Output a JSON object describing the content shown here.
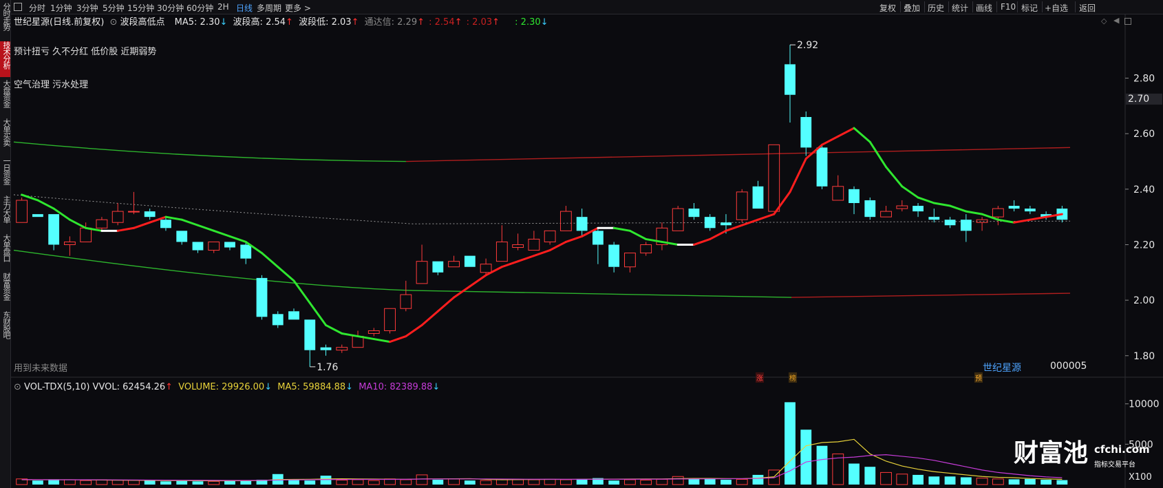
{
  "sidebar": {
    "tabs": [
      {
        "label": "分时走势",
        "active": false
      },
      {
        "label": "技术分析",
        "active": true
      },
      {
        "label": "大盘资金",
        "active": false
      },
      {
        "label": "大单买卖",
        "active": false
      },
      {
        "label": "一日资金",
        "active": false
      },
      {
        "label": "主力大单",
        "active": false
      },
      {
        "label": "大单盘口",
        "active": false
      },
      {
        "label": "财富资金",
        "active": false
      },
      {
        "label": "东财股吧",
        "active": false
      }
    ]
  },
  "toolbar": {
    "periods": [
      "分时",
      "1分钟",
      "3分钟",
      "5分钟",
      "15分钟",
      "30分钟",
      "60分钟",
      "2H",
      "日线",
      "多周期",
      "更多 >"
    ],
    "active_period": "日线",
    "tools": [
      "复权",
      "叠加",
      "历史",
      "统计",
      "画线",
      "F10",
      "标记",
      "+自选",
      "返回"
    ]
  },
  "main_header": {
    "stock_name": "世纪星源",
    "mode": "(日线.前复权)",
    "indicator": "波段高低点",
    "ma5_label": "MA5:",
    "ma5_value": "2.30",
    "ma5_arrow": "↓",
    "high_label": "波段高:",
    "high_value": "2.54",
    "high_arrow": "↑",
    "low_label": "波段低:",
    "low_value": "2.03",
    "low_arrow": "↑",
    "channel_label": "通达信:",
    "channel_value": "2.29",
    "channel_arrow": "↑",
    "extra1_value": ": 2.54",
    "extra1_arrow": "↑",
    "extra2_value": ": 2.03",
    "extra2_arrow": "↑",
    "extra3_value": ": 2.30",
    "extra3_arrow": "↓"
  },
  "tags": {
    "line1": "预计扭亏 久不分红 低价股 近期弱势",
    "line2": "空气治理 污水处理"
  },
  "footer_label": "用到未来数据",
  "stock_watermark": "世纪星源",
  "stock_code": "000005",
  "markers": [
    "涨",
    "榜",
    "预"
  ],
  "right_price_tag": "2.70",
  "vol_header": {
    "name": "VOL-TDX(5,10)",
    "vvol_label": "VVOL:",
    "vvol_value": "62454.26",
    "vvol_arrow": "↑",
    "volume_label": "VOLUME:",
    "volume_value": "29926.00",
    "volume_arrow": "↓",
    "ma5_label": "MA5:",
    "ma5_value": "59884.88",
    "ma5_arrow": "↓",
    "ma10_label": "MA10:",
    "ma10_value": "82389.88",
    "ma10_arrow": "↓"
  },
  "brand": {
    "logo": "财富池",
    "domain": "cfchi.com",
    "slogan": "指标交易平台"
  },
  "vol_unit": "X100",
  "colors": {
    "up": "#ff3b3b",
    "down": "#54ffff",
    "ma_up": "#ff1e1e",
    "ma_down": "#2fe62f",
    "channel_green": "#2db52d",
    "channel_red": "#b01e1e",
    "vol_ma5": "#e8d23a",
    "vol_ma10": "#c63cd8",
    "accent_blue": "#4ea4ff"
  },
  "chart_data": {
    "type": "candlestick",
    "title": "世纪星源(日线.前复权)",
    "price_axis": {
      "ticks": [
        1.8,
        2.0,
        2.2,
        2.4,
        2.6,
        2.8
      ],
      "range": [
        1.73,
        2.97
      ]
    },
    "annotations": [
      {
        "label": "2.92",
        "value": 2.92
      },
      {
        "label": "1.76",
        "value": 1.76
      }
    ],
    "candles": [
      {
        "o": 2.28,
        "c": 2.36,
        "h": 2.37,
        "l": 2.28
      },
      {
        "o": 2.31,
        "c": 2.3,
        "h": 2.31,
        "l": 2.3
      },
      {
        "o": 2.31,
        "c": 2.2,
        "h": 2.31,
        "l": 2.18
      },
      {
        "o": 2.2,
        "c": 2.21,
        "h": 2.23,
        "l": 2.16
      },
      {
        "o": 2.21,
        "c": 2.26,
        "h": 2.28,
        "l": 2.21
      },
      {
        "o": 2.26,
        "c": 2.29,
        "h": 2.3,
        "l": 2.25
      },
      {
        "o": 2.28,
        "c": 2.32,
        "h": 2.35,
        "l": 2.27
      },
      {
        "o": 2.32,
        "c": 2.32,
        "h": 2.39,
        "l": 2.31
      },
      {
        "o": 2.32,
        "c": 2.3,
        "h": 2.33,
        "l": 2.29
      },
      {
        "o": 2.29,
        "c": 2.26,
        "h": 2.3,
        "l": 2.25
      },
      {
        "o": 2.25,
        "c": 2.21,
        "h": 2.25,
        "l": 2.2
      },
      {
        "o": 2.21,
        "c": 2.18,
        "h": 2.21,
        "l": 2.17
      },
      {
        "o": 2.18,
        "c": 2.21,
        "h": 2.21,
        "l": 2.17
      },
      {
        "o": 2.21,
        "c": 2.19,
        "h": 2.21,
        "l": 2.18
      },
      {
        "o": 2.2,
        "c": 2.15,
        "h": 2.21,
        "l": 2.13
      },
      {
        "o": 2.08,
        "c": 1.94,
        "h": 2.09,
        "l": 1.93
      },
      {
        "o": 1.95,
        "c": 1.91,
        "h": 1.96,
        "l": 1.9
      },
      {
        "o": 1.96,
        "c": 1.93,
        "h": 1.97,
        "l": 1.93
      },
      {
        "o": 1.93,
        "c": 1.82,
        "h": 1.93,
        "l": 1.76
      },
      {
        "o": 1.83,
        "c": 1.82,
        "h": 1.84,
        "l": 1.8
      },
      {
        "o": 1.82,
        "c": 1.83,
        "h": 1.84,
        "l": 1.81
      },
      {
        "o": 1.83,
        "c": 1.87,
        "h": 1.89,
        "l": 1.83
      },
      {
        "o": 1.88,
        "c": 1.89,
        "h": 1.9,
        "l": 1.87
      },
      {
        "o": 1.89,
        "c": 1.97,
        "h": 1.97,
        "l": 1.88
      },
      {
        "o": 1.97,
        "c": 2.02,
        "h": 2.07,
        "l": 1.96
      },
      {
        "o": 2.06,
        "c": 2.14,
        "h": 2.2,
        "l": 2.06
      },
      {
        "o": 2.14,
        "c": 2.1,
        "h": 2.14,
        "l": 2.09
      },
      {
        "o": 2.12,
        "c": 2.14,
        "h": 2.16,
        "l": 2.12
      },
      {
        "o": 2.16,
        "c": 2.12,
        "h": 2.16,
        "l": 2.12
      },
      {
        "o": 2.1,
        "c": 2.13,
        "h": 2.15,
        "l": 2.09
      },
      {
        "o": 2.14,
        "c": 2.21,
        "h": 2.27,
        "l": 2.14
      },
      {
        "o": 2.19,
        "c": 2.2,
        "h": 2.24,
        "l": 2.18
      },
      {
        "o": 2.18,
        "c": 2.22,
        "h": 2.25,
        "l": 2.18
      },
      {
        "o": 2.21,
        "c": 2.25,
        "h": 2.25,
        "l": 2.2
      },
      {
        "o": 2.25,
        "c": 2.32,
        "h": 2.34,
        "l": 2.25
      },
      {
        "o": 2.3,
        "c": 2.25,
        "h": 2.33,
        "l": 2.23
      },
      {
        "o": 2.25,
        "c": 2.2,
        "h": 2.26,
        "l": 2.13
      },
      {
        "o": 2.2,
        "c": 2.12,
        "h": 2.21,
        "l": 2.1
      },
      {
        "o": 2.12,
        "c": 2.17,
        "h": 2.17,
        "l": 2.1
      },
      {
        "o": 2.17,
        "c": 2.2,
        "h": 2.21,
        "l": 2.16
      },
      {
        "o": 2.2,
        "c": 2.26,
        "h": 2.28,
        "l": 2.18
      },
      {
        "o": 2.25,
        "c": 2.33,
        "h": 2.34,
        "l": 2.25
      },
      {
        "o": 2.33,
        "c": 2.3,
        "h": 2.35,
        "l": 2.29
      },
      {
        "o": 2.3,
        "c": 2.26,
        "h": 2.31,
        "l": 2.25
      },
      {
        "o": 2.28,
        "c": 2.27,
        "h": 2.31,
        "l": 2.24
      },
      {
        "o": 2.29,
        "c": 2.39,
        "h": 2.4,
        "l": 2.28
      },
      {
        "o": 2.41,
        "c": 2.33,
        "h": 2.43,
        "l": 2.33
      },
      {
        "o": 2.32,
        "c": 2.56,
        "h": 2.56,
        "l": 2.32
      },
      {
        "o": 2.85,
        "c": 2.74,
        "h": 2.92,
        "l": 2.64
      },
      {
        "o": 2.66,
        "c": 2.55,
        "h": 2.68,
        "l": 2.52
      },
      {
        "o": 2.55,
        "c": 2.41,
        "h": 2.56,
        "l": 2.4
      },
      {
        "o": 2.36,
        "c": 2.41,
        "h": 2.45,
        "l": 2.36
      },
      {
        "o": 2.4,
        "c": 2.35,
        "h": 2.41,
        "l": 2.31
      },
      {
        "o": 2.36,
        "c": 2.3,
        "h": 2.37,
        "l": 2.29
      },
      {
        "o": 2.3,
        "c": 2.32,
        "h": 2.34,
        "l": 2.3
      },
      {
        "o": 2.33,
        "c": 2.34,
        "h": 2.36,
        "l": 2.32
      },
      {
        "o": 2.34,
        "c": 2.32,
        "h": 2.35,
        "l": 2.3
      },
      {
        "o": 2.3,
        "c": 2.29,
        "h": 2.33,
        "l": 2.28
      },
      {
        "o": 2.29,
        "c": 2.27,
        "h": 2.3,
        "l": 2.26
      },
      {
        "o": 2.29,
        "c": 2.25,
        "h": 2.31,
        "l": 2.21
      },
      {
        "o": 2.28,
        "c": 2.29,
        "h": 2.3,
        "l": 2.25
      },
      {
        "o": 2.3,
        "c": 2.33,
        "h": 2.34,
        "l": 2.27
      },
      {
        "o": 2.34,
        "c": 2.33,
        "h": 2.36,
        "l": 2.32
      },
      {
        "o": 2.33,
        "c": 2.32,
        "h": 2.34,
        "l": 2.31
      },
      {
        "o": 2.31,
        "c": 2.3,
        "h": 2.32,
        "l": 2.29
      },
      {
        "o": 2.33,
        "c": 2.29,
        "h": 2.34,
        "l": 2.28
      }
    ],
    "ma5": [
      2.38,
      2.36,
      2.33,
      2.29,
      2.26,
      2.25,
      2.25,
      2.26,
      2.28,
      2.3,
      2.29,
      2.27,
      2.25,
      2.23,
      2.21,
      2.17,
      2.12,
      2.07,
      1.99,
      1.91,
      1.88,
      1.87,
      1.86,
      1.85,
      1.87,
      1.91,
      1.96,
      2.01,
      2.05,
      2.09,
      2.12,
      2.14,
      2.16,
      2.18,
      2.21,
      2.23,
      2.26,
      2.26,
      2.25,
      2.22,
      2.21,
      2.2,
      2.2,
      2.22,
      2.25,
      2.27,
      2.29,
      2.31,
      2.39,
      2.51,
      2.56,
      2.59,
      2.62,
      2.57,
      2.48,
      2.41,
      2.37,
      2.35,
      2.34,
      2.32,
      2.31,
      2.29,
      2.28,
      2.29,
      2.3,
      2.31,
      2.31,
      2.31,
      2.29
    ],
    "channel_upper": [
      2.57,
      2.5,
      2.5,
      2.55
    ],
    "channel_lower": [
      2.18,
      2.03,
      2.01,
      2.02
    ],
    "channel_mid": [
      2.38,
      2.31,
      2.28,
      2.29
    ],
    "volume_axis": {
      "ticks": [
        5000,
        10000
      ],
      "unit": "X100"
    },
    "volume": [
      700,
      500,
      650,
      600,
      500,
      600,
      550,
      550,
      500,
      400,
      450,
      400,
      400,
      500,
      450,
      600,
      1300,
      600,
      500,
      1100,
      550,
      600,
      500,
      700,
      600,
      1200,
      600,
      700,
      500,
      500,
      600,
      600,
      600,
      650,
      600,
      700,
      800,
      500,
      600,
      550,
      650,
      1000,
      700,
      700,
      600,
      650,
      1200,
      1800,
      10200,
      6800,
      4800,
      3800,
      2600,
      2200,
      1500,
      1300,
      1200,
      1000,
      1000,
      900,
      800,
      700,
      650,
      700,
      600,
      550,
      500
    ],
    "volume_ma5": [
      600,
      600,
      600,
      600,
      580,
      560,
      540,
      530,
      520,
      500,
      500,
      480,
      470,
      470,
      480,
      500,
      620,
      640,
      650,
      700,
      720,
      700,
      680,
      660,
      650,
      700,
      710,
      720,
      730,
      650,
      600,
      620,
      630,
      640,
      640,
      650,
      670,
      670,
      680,
      690,
      700,
      740,
      760,
      760,
      740,
      730,
      800,
      960,
      2900,
      4800,
      5200,
      5300,
      5600,
      3800,
      2900,
      2300,
      1900,
      1600,
      1400,
      1200,
      1000,
      900,
      850,
      750,
      700,
      650,
      600
    ],
    "volume_ma10": [
      620,
      610,
      600,
      600,
      600,
      590,
      580,
      570,
      560,
      550,
      540,
      530,
      520,
      510,
      510,
      520,
      560,
      580,
      600,
      620,
      630,
      640,
      640,
      640,
      650,
      680,
      690,
      700,
      700,
      700,
      680,
      670,
      660,
      660,
      650,
      650,
      660,
      660,
      660,
      660,
      670,
      690,
      700,
      710,
      720,
      730,
      760,
      840,
      1700,
      2800,
      3100,
      3300,
      3400,
      3600,
      3700,
      3500,
      3300,
      3000,
      2600,
      2200,
      1800,
      1500,
      1300,
      1100,
      950,
      850,
      700
    ]
  }
}
